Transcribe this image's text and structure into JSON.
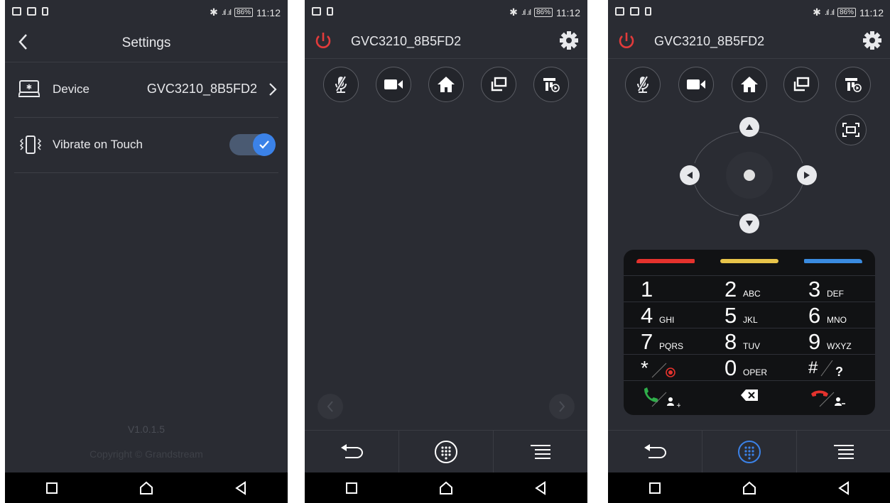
{
  "status_bar": {
    "time": "11:12",
    "battery": "86%"
  },
  "settings": {
    "title": "Settings",
    "device_label": "Device",
    "device_value": "GVC3210_8B5FD2",
    "vibrate_label": "Vibrate on Touch",
    "vibrate_on": true,
    "version": "V1.0.1.5",
    "copyright": "Copyright © Grandstream"
  },
  "remote": {
    "device_name": "GVC3210_8B5FD2",
    "quick_buttons": [
      "mic-mute-icon",
      "camera-icon",
      "home-icon",
      "window-icon",
      "presentation-icon"
    ]
  },
  "keypad": {
    "keys": [
      {
        "digit": "1",
        "letters": ""
      },
      {
        "digit": "2",
        "letters": "ABC"
      },
      {
        "digit": "3",
        "letters": "DEF"
      },
      {
        "digit": "4",
        "letters": "GHI"
      },
      {
        "digit": "5",
        "letters": "JKL"
      },
      {
        "digit": "6",
        "letters": "MNO"
      },
      {
        "digit": "7",
        "letters": "PQRS"
      },
      {
        "digit": "8",
        "letters": "TUV"
      },
      {
        "digit": "9",
        "letters": "WXYZ"
      },
      {
        "digit": "*",
        "letters": ""
      },
      {
        "digit": "0",
        "letters": "OPER"
      },
      {
        "digit": "#",
        "letters": ""
      }
    ],
    "function_key_colors": [
      "#e5322d",
      "#e8c44a",
      "#3a8be0"
    ],
    "extra": {
      "question": "?"
    }
  },
  "colors": {
    "accent": "#3b82e8",
    "power": "#e23b3b",
    "background": "#2a2c33"
  }
}
